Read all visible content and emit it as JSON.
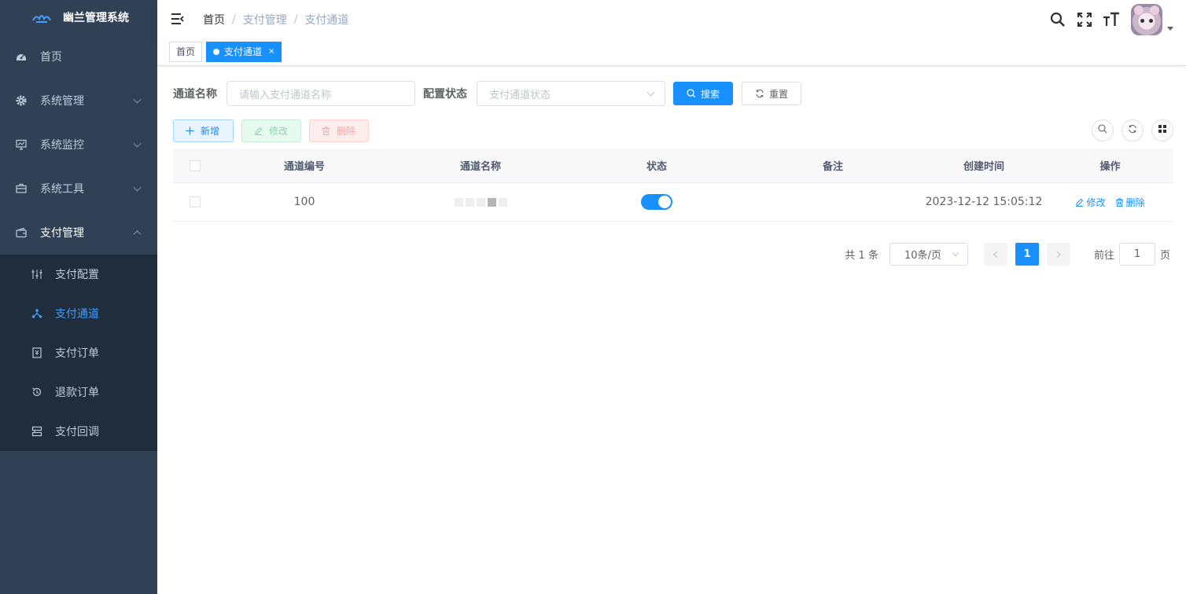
{
  "app": {
    "title": "幽兰管理系统"
  },
  "sidebar": {
    "items": [
      {
        "label": "首页",
        "icon": "dashboard-icon"
      },
      {
        "label": "系统管理",
        "icon": "gear-icon"
      },
      {
        "label": "系统监控",
        "icon": "monitor-icon"
      },
      {
        "label": "系统工具",
        "icon": "toolbox-icon"
      },
      {
        "label": "支付管理",
        "icon": "wallet-icon"
      }
    ],
    "submenu": [
      {
        "label": "支付配置",
        "icon": "sliders-icon"
      },
      {
        "label": "支付通道",
        "icon": "nodes-icon",
        "active": true
      },
      {
        "label": "支付订单",
        "icon": "order-icon"
      },
      {
        "label": "退款订单",
        "icon": "refund-icon"
      },
      {
        "label": "支付回调",
        "icon": "callback-icon"
      }
    ]
  },
  "breadcrumb": [
    "首页",
    "支付管理",
    "支付通道"
  ],
  "breadcrumb_sep": "/",
  "tags": {
    "home": "首页",
    "active": "支付通道",
    "close": "×"
  },
  "search": {
    "name_label": "通道名称",
    "name_placeholder": "请输入支付通道名称",
    "status_label": "配置状态",
    "status_placeholder": "支付通道状态",
    "search_btn": "搜索",
    "reset_btn": "重置"
  },
  "toolbar": {
    "add": "新增",
    "edit": "修改",
    "delete": "删除"
  },
  "table": {
    "headers": [
      "通道编号",
      "通道名称",
      "状态",
      "备注",
      "创建时间",
      "操作"
    ],
    "rows": [
      {
        "id": "100",
        "remark": "",
        "created": "2023-12-12 15:05:12",
        "status_on": true,
        "edit": "修改",
        "delete": "删除"
      }
    ]
  },
  "pagination": {
    "total": "共 1 条",
    "page_size": "10条/页",
    "current": "1",
    "goto_label": "前往",
    "goto_value": "1",
    "goto_unit": "页"
  },
  "colors": {
    "primary": "#1890ff",
    "sidebar": "#304156",
    "submenu": "#1f2d3d"
  }
}
